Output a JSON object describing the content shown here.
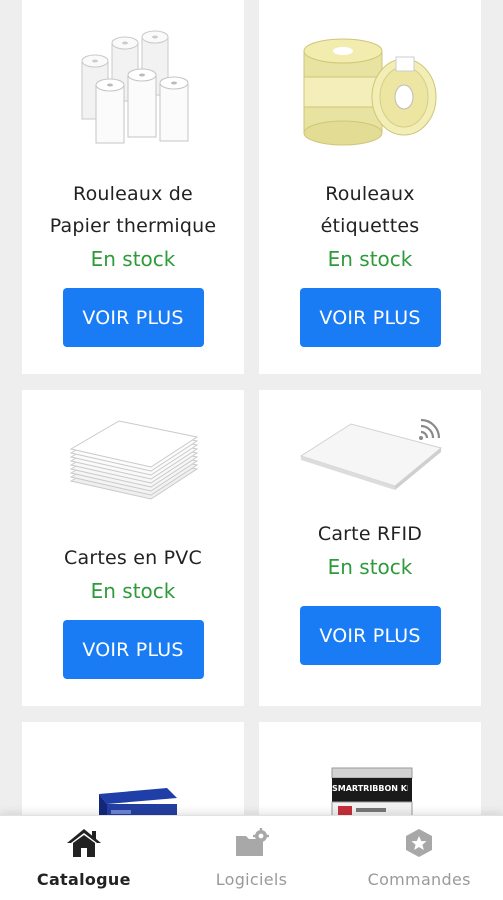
{
  "products": [
    {
      "name_line1": "Rouleaux de",
      "name_line2": "Papier thermique",
      "stock": "En stock",
      "button": "VOIR PLUS",
      "icon": "thermal-paper-rolls-image"
    },
    {
      "name_line1": "Rouleaux",
      "name_line2": "étiquettes",
      "stock": "En stock",
      "button": "VOIR PLUS",
      "icon": "label-rolls-image"
    },
    {
      "name_line1": "Cartes en PVC",
      "stock": "En stock",
      "button": "VOIR PLUS",
      "icon": "pvc-cards-image"
    },
    {
      "name_line1": "Carte RFID",
      "stock": "En stock",
      "button": "VOIR PLUS",
      "icon": "rfid-card-image"
    },
    {
      "icon": "printer-ribbon-box-image"
    },
    {
      "icon": "smart-ribbon-kit-image",
      "box_text": "SMARTRIBBON KIT"
    }
  ],
  "nav": {
    "items": [
      {
        "label": "Catalogue",
        "icon": "home-icon",
        "active": true
      },
      {
        "label": "Logiciels",
        "icon": "folder-settings-icon",
        "active": false
      },
      {
        "label": "Commandes",
        "icon": "star-badge-icon",
        "active": false
      }
    ]
  },
  "colors": {
    "button": "#1a7cf5",
    "stock_green": "#2e9b3a",
    "background": "#eeeeee",
    "nav_active": "#222222",
    "nav_inactive": "#9a9a9a"
  }
}
